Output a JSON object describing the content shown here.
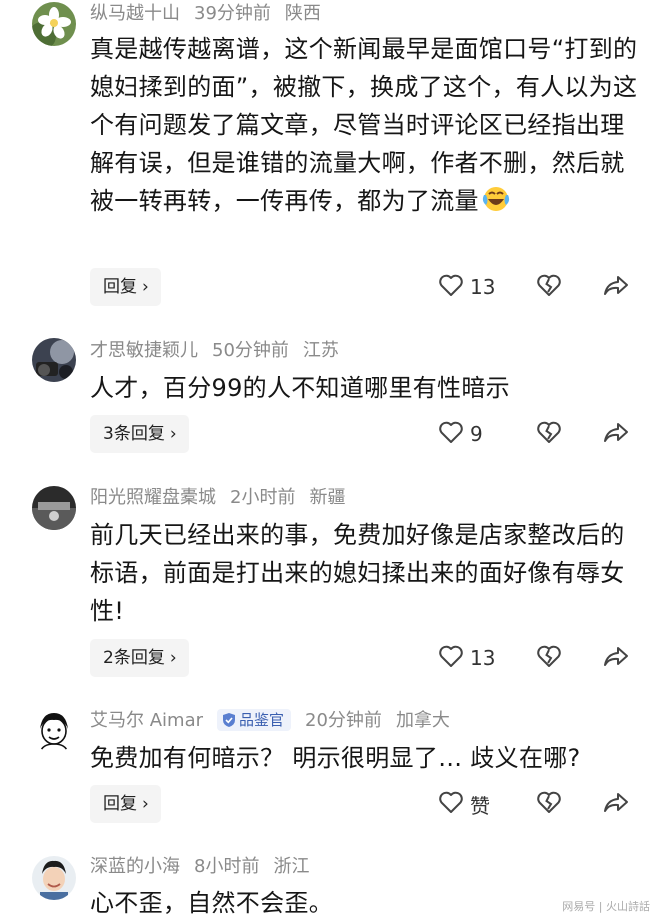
{
  "comments": [
    {
      "username": "纵马越十山",
      "time": "39分钟前",
      "location": "陕西",
      "text": "真是越传越离谱，这个新闻最早是面馆口号“打到的媳妇揉到的面”，被撤下，换成了这个，有人以为这个有问题发了篇文章，尽管当时评论区已经指出理解有误，但是谁错的流量大啊，作者不删，然后就被一转再转，一传再传，都为了流量",
      "emoji": "laugh-cry-emoji",
      "reply_label": "回复",
      "likes": "13"
    },
    {
      "username": "才思敏捷颖儿",
      "time": "50分钟前",
      "location": "江苏",
      "text": "人才，百分99的人不知道哪里有性暗示",
      "reply_label": "3条回复",
      "likes": "9"
    },
    {
      "username": "阳光照耀盘橐城",
      "time": "2小时前",
      "location": "新疆",
      "text": "前几天已经出来的事，免费加好像是店家整改后的标语，前面是打出来的媳妇揉出来的面好像有辱女性!",
      "reply_label": "2条回复",
      "likes": "13"
    },
    {
      "username": "艾马尔 Aimar",
      "badge": "品鉴官",
      "time": "20分钟前",
      "location": "加拿大",
      "text": "免费加有何暗示？ 明示很明显了… 歧义在哪?",
      "reply_label": "回复",
      "likes": "赞"
    },
    {
      "username": "深蓝的小海",
      "time": "8小时前",
      "location": "浙江",
      "text": "心不歪，自然不会歪。"
    }
  ],
  "watermark": "网易号 | 火山詩話",
  "colors": {
    "meta": "#8a8a8a",
    "badge_bg": "#eef2fb",
    "badge_text": "#3a5fb0",
    "reply_bg": "#f4f4f4"
  }
}
